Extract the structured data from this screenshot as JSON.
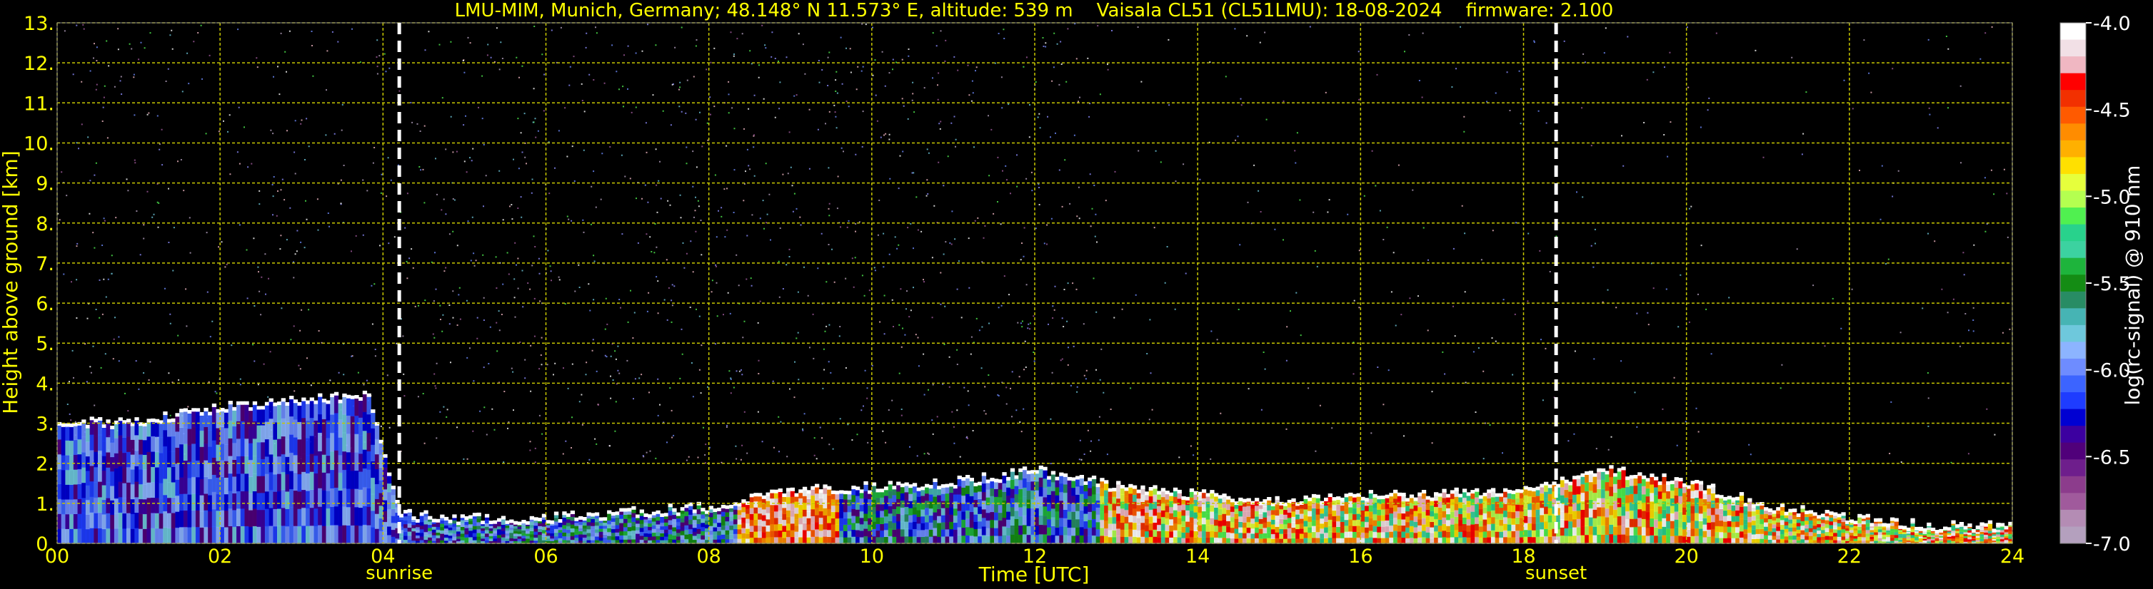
{
  "chart_data": {
    "type": "heatmap",
    "title": "LMU-MIM, Munich, Germany; 48.148° N 11.573° E, altitude: 539 m    Vaisala CL51 (CL51LMU): 18-08-2024    firmware: 2.100",
    "xlabel": "Time [UTC]",
    "ylabel": "Height above ground [km]",
    "xlim": [
      0,
      24
    ],
    "ylim": [
      0,
      13
    ],
    "x_ticks": [
      "00",
      "02",
      "04",
      "06",
      "08",
      "10",
      "12",
      "14",
      "16",
      "18",
      "20",
      "22",
      "24"
    ],
    "y_ticks": [
      "0.",
      "1.",
      "2.",
      "3.",
      "4.",
      "5.",
      "6.",
      "7.",
      "8.",
      "9.",
      "10.",
      "11.",
      "12.",
      "13."
    ],
    "grid": true,
    "markers": [
      {
        "label": "sunrise",
        "time": 4.2
      },
      {
        "label": "sunset",
        "time": 18.4
      }
    ],
    "colorbar": {
      "label": "log(rc-signal) @ 910 nm",
      "range": [
        -7.0,
        -4.0
      ],
      "tick_labels": [
        "-4.0",
        "-4.5",
        "-5.0",
        "-5.5",
        "-6.0",
        "-6.5",
        "-7.0"
      ],
      "colors": [
        "#ffffff",
        "#f2e0e6",
        "#f0b7c2",
        "#ff0000",
        "#f23000",
        "#ff5a00",
        "#ff8c00",
        "#ffb000",
        "#ffe000",
        "#e6ff3c",
        "#b4ff50",
        "#50f050",
        "#28d28c",
        "#3cd2a0",
        "#1eb43c",
        "#148c14",
        "#288c64",
        "#46b4b4",
        "#6ec8dc",
        "#8cb4ff",
        "#6e8cff",
        "#3c64ff",
        "#1e3cff",
        "#0000d2",
        "#3c00a0",
        "#50007a",
        "#6e1e8c",
        "#8c3c8c",
        "#a05a9c",
        "#b48cb4",
        "#b4a0be"
      ]
    },
    "cloud_base_km": [
      [
        0.0,
        3.0
      ],
      [
        1.0,
        3.0
      ],
      [
        2.0,
        3.4
      ],
      [
        3.0,
        3.6
      ],
      [
        3.8,
        3.7
      ],
      [
        4.2,
        0.7
      ],
      [
        5.0,
        0.6
      ],
      [
        6.0,
        0.6
      ],
      [
        7.0,
        0.75
      ],
      [
        8.0,
        0.9
      ],
      [
        9.0,
        1.3
      ],
      [
        10.0,
        1.4
      ],
      [
        11.0,
        1.5
      ],
      [
        12.0,
        1.8
      ],
      [
        13.0,
        1.4
      ],
      [
        14.0,
        1.2
      ],
      [
        15.0,
        1.0
      ],
      [
        16.0,
        1.2
      ],
      [
        17.0,
        1.2
      ],
      [
        18.0,
        1.3
      ],
      [
        19.0,
        1.8
      ],
      [
        20.0,
        1.5
      ],
      [
        21.0,
        0.9
      ],
      [
        22.0,
        0.6
      ],
      [
        23.0,
        0.4
      ],
      [
        24.0,
        0.4
      ]
    ]
  }
}
